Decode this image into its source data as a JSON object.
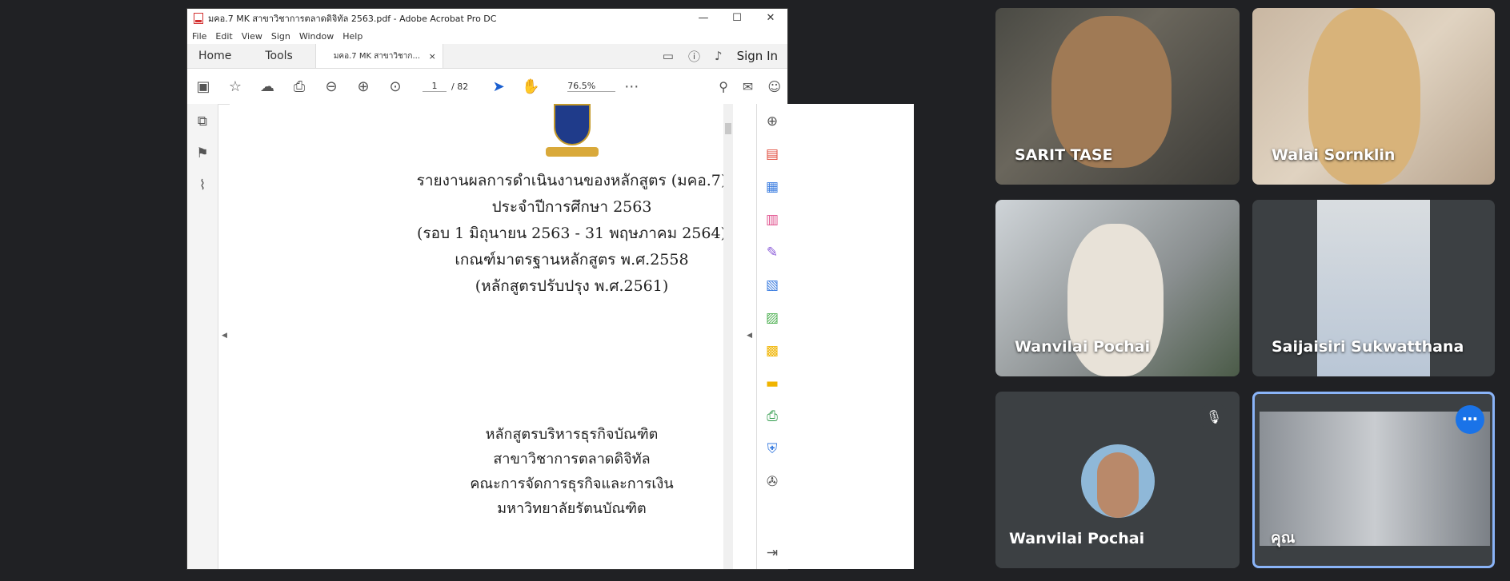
{
  "acrobat": {
    "window_title": "มคอ.7 MK สาขาวิชาการตลาดดิจิทัล 2563.pdf - Adobe Acrobat Pro DC",
    "window_controls": [
      "—",
      "☐",
      "✕"
    ],
    "menu": [
      "File",
      "Edit",
      "View",
      "Sign",
      "Window",
      "Help"
    ],
    "nav_tabs": [
      "Home",
      "Tools"
    ],
    "doc_tab_label": "มคอ.7 MK สาขาวิชาก...",
    "doc_tab_close": "×",
    "sign_in": "Sign In",
    "page_current": "1",
    "page_total": "/ 82",
    "zoom": "76.5%",
    "page_lines_top": [
      "รายงานผลการดำเนินงานของหลักสูตร (มคอ.7)",
      "ประจำปีการศึกษา 2563",
      "(รอบ 1 มิถุนายน 2563 - 31 พฤษภาคม 2564)",
      "เกณฑ์มาตรฐานหลักสูตร พ.ศ.2558",
      "(หลักสูตรปรับปรุง พ.ศ.2561)"
    ],
    "page_lines_bottom": [
      "หลักสูตรบริหารธุรกิจบัณฑิต",
      "สาขาวิชาการตลาดดิจิทัล",
      "คณะการจัดการธุรกิจและการเงิน",
      "มหาวิทยาลัยรัตนบัณฑิต"
    ]
  },
  "meet": {
    "participants": [
      {
        "name": "SARIT TASE"
      },
      {
        "name": "Walai Sornklin"
      },
      {
        "name": "Wanvilai Pochai"
      },
      {
        "name": "Saijaisiri Sukwatthana"
      },
      {
        "name": "Wanvilai Pochai"
      },
      {
        "name": "คุณ"
      }
    ],
    "colors": {
      "background": "#202124",
      "tile": "#3c4043",
      "active_border": "#8ab4f8",
      "more_button": "#1a73e8"
    }
  }
}
